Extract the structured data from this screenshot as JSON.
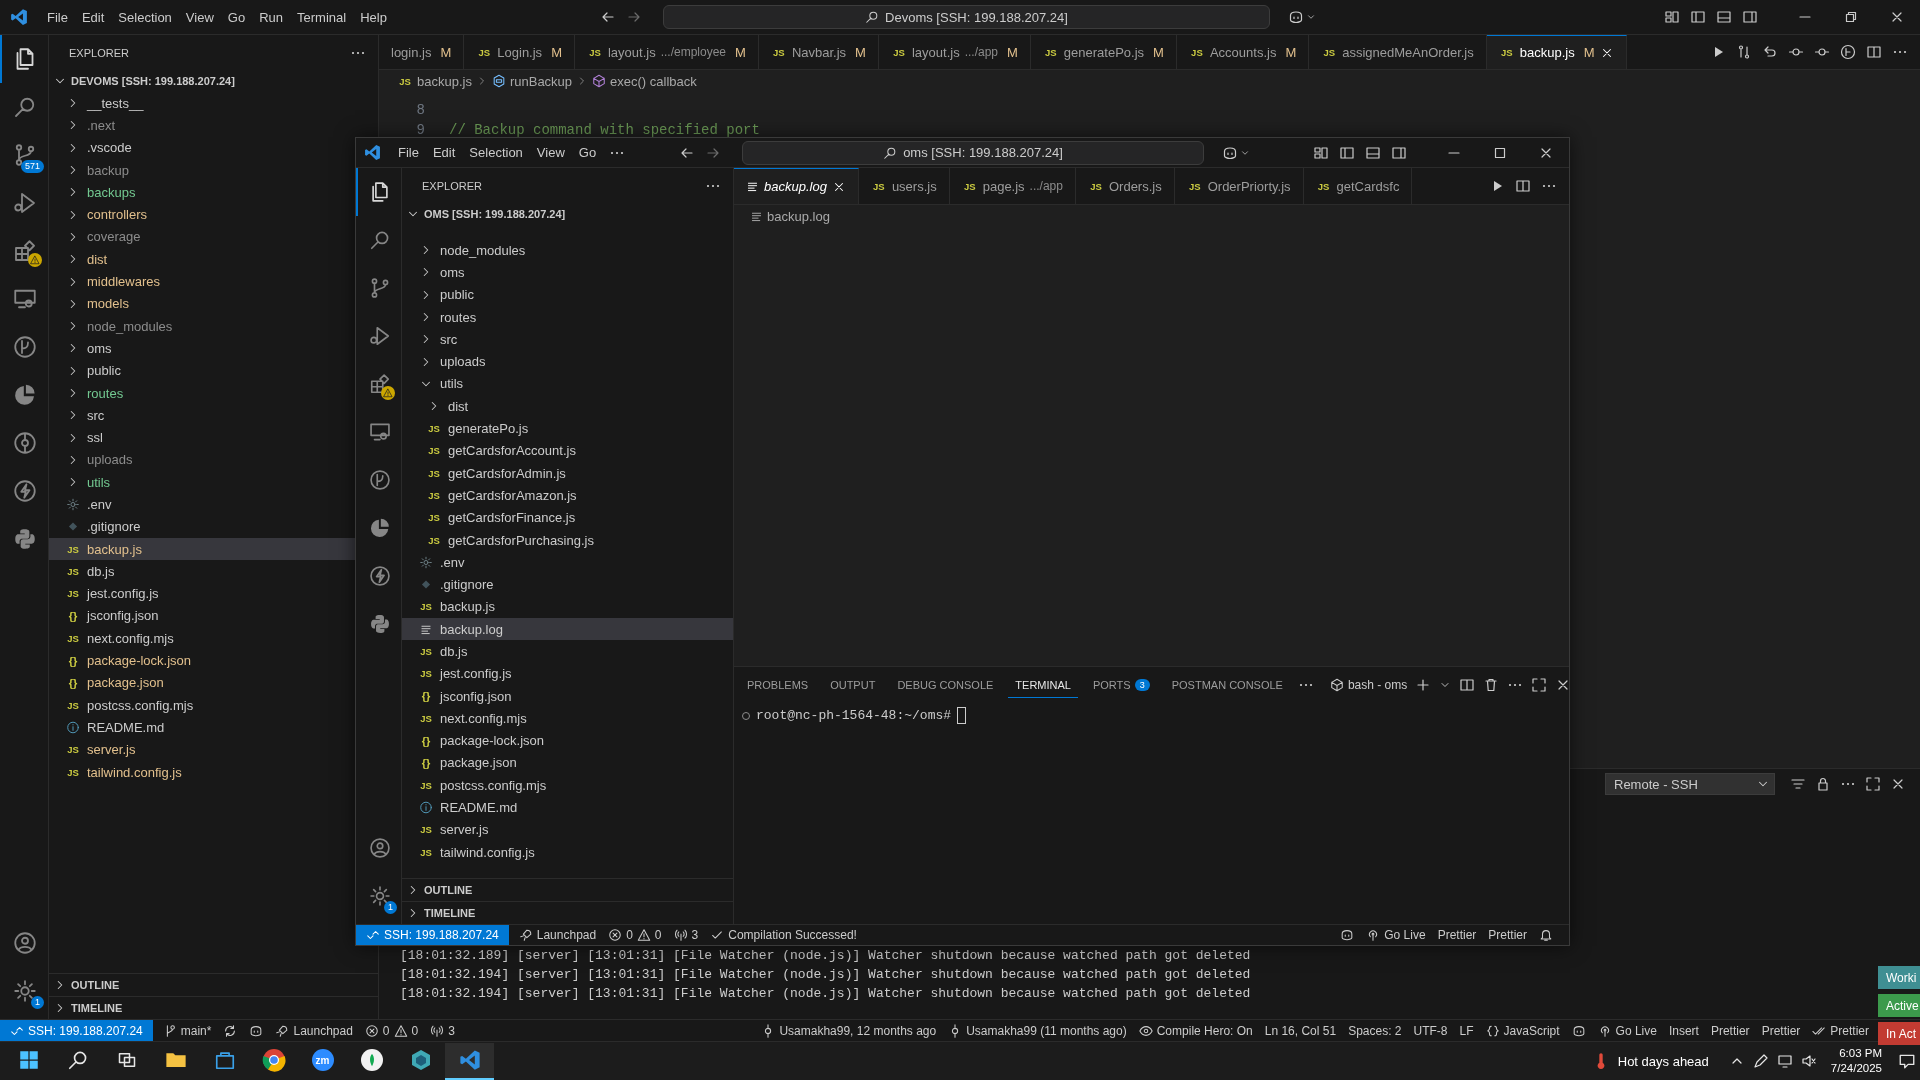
{
  "title_bar": {
    "menu": [
      "File",
      "Edit",
      "Selection",
      "View",
      "Go",
      "Run",
      "Terminal",
      "Help"
    ],
    "search": "Devoms [SSH: 199.188.207.24]"
  },
  "activity_bar": {
    "top": [
      {
        "kind": "files",
        "selected": true
      },
      {
        "kind": "search",
        "selected": false
      },
      {
        "kind": "scm",
        "selected": false,
        "badge": "571"
      },
      {
        "kind": "debug",
        "selected": false
      },
      {
        "kind": "extensions",
        "selected": false,
        "alert": true
      },
      {
        "kind": "remote",
        "selected": false
      },
      {
        "kind": "gitgraph",
        "selected": false
      },
      {
        "kind": "pie",
        "selected": false
      },
      {
        "kind": "gitlens",
        "selected": false
      },
      {
        "kind": "bolt",
        "selected": false
      },
      {
        "kind": "python",
        "selected": false
      }
    ],
    "bottom": [
      {
        "kind": "account",
        "selected": false
      },
      {
        "kind": "settings",
        "selected": false,
        "badge": "1"
      }
    ]
  },
  "explorer": {
    "title": "EXPLORER",
    "root": "DEVOMS [SSH: 199.188.207.24]",
    "items": [
      {
        "kind": "folder",
        "name": "__tests__",
        "color": "#cccccc",
        "expanded": false,
        "selected": false
      },
      {
        "kind": "folder",
        "name": ".next",
        "color": "#8c8c8c",
        "expanded": false,
        "selected": false
      },
      {
        "kind": "folder",
        "name": ".vscode",
        "color": "#cccccc",
        "expanded": false,
        "selected": false
      },
      {
        "kind": "folder",
        "name": "backup",
        "color": "#8c8c8c",
        "expanded": false,
        "selected": false
      },
      {
        "kind": "folder",
        "name": "backups",
        "color": "#73c991",
        "expanded": false,
        "selected": false
      },
      {
        "kind": "folder",
        "name": "controllers",
        "color": "#e2c08d",
        "expanded": false,
        "selected": false
      },
      {
        "kind": "folder",
        "name": "coverage",
        "color": "#8c8c8c",
        "expanded": false,
        "selected": false
      },
      {
        "kind": "folder",
        "name": "dist",
        "color": "#e2c08d",
        "expanded": false,
        "selected": false
      },
      {
        "kind": "folder",
        "name": "middlewares",
        "color": "#e2c08d",
        "expanded": false,
        "selected": false
      },
      {
        "kind": "folder",
        "name": "models",
        "color": "#e2c08d",
        "expanded": false,
        "selected": false
      },
      {
        "kind": "folder",
        "name": "node_modules",
        "color": "#8c8c8c",
        "expanded": false,
        "selected": false
      },
      {
        "kind": "folder",
        "name": "oms",
        "color": "#cccccc",
        "expanded": false,
        "selected": false
      },
      {
        "kind": "folder",
        "name": "public",
        "color": "#cccccc",
        "expanded": false,
        "selected": false
      },
      {
        "kind": "folder",
        "name": "routes",
        "color": "#73c991",
        "expanded": false,
        "selected": false
      },
      {
        "kind": "folder",
        "name": "src",
        "color": "#cccccc",
        "expanded": false,
        "selected": false
      },
      {
        "kind": "folder",
        "name": "ssl",
        "color": "#cccccc",
        "expanded": false,
        "selected": false
      },
      {
        "kind": "folder",
        "name": "uploads",
        "color": "#8c8c8c",
        "expanded": false,
        "selected": false
      },
      {
        "kind": "folder",
        "name": "utils",
        "color": "#73c991",
        "expanded": false,
        "selected": false
      },
      {
        "kind": "env",
        "name": ".env",
        "color": "#cccccc",
        "selected": false
      },
      {
        "kind": "git",
        "name": ".gitignore",
        "color": "#cccccc",
        "selected": false
      },
      {
        "kind": "js",
        "glyph": "JS",
        "name": "backup.js",
        "color": "#e2c08d",
        "selected": true
      },
      {
        "kind": "js",
        "glyph": "JS",
        "name": "db.js",
        "color": "#cccccc",
        "selected": false
      },
      {
        "kind": "js",
        "glyph": "JS",
        "name": "jest.config.js",
        "color": "#cccccc",
        "selected": false
      },
      {
        "kind": "json",
        "glyph": "{}",
        "name": "jsconfig.json",
        "color": "#cccccc",
        "selected": false
      },
      {
        "kind": "js",
        "glyph": "JS",
        "name": "next.config.mjs",
        "color": "#cccccc",
        "selected": false
      },
      {
        "kind": "json",
        "glyph": "{}",
        "name": "package-lock.json",
        "color": "#e2c08d",
        "selected": false
      },
      {
        "kind": "json",
        "glyph": "{}",
        "name": "package.json",
        "color": "#e2c08d",
        "selected": false
      },
      {
        "kind": "js",
        "glyph": "JS",
        "name": "postcss.config.mjs",
        "color": "#cccccc",
        "selected": false
      },
      {
        "kind": "info",
        "name": "README.md",
        "color": "#cccccc",
        "selected": false
      },
      {
        "kind": "js",
        "glyph": "JS",
        "name": "server.js",
        "color": "#e2c08d",
        "selected": false
      },
      {
        "kind": "js",
        "glyph": "JS",
        "name": "tailwind.config.js",
        "color": "#e2c08d",
        "selected": false
      }
    ],
    "sections": [
      "OUTLINE",
      "TIMELINE"
    ]
  },
  "tabs": [
    {
      "name": "login.js",
      "status": "M",
      "selected": false
    },
    {
      "glyph": "JS",
      "name": "Login.js",
      "status": "M",
      "selected": false
    },
    {
      "glyph": "JS",
      "name": "layout.js",
      "desc": ".../employee",
      "status": "M",
      "selected": false
    },
    {
      "glyph": "JS",
      "name": "Navbar.js",
      "status": "M",
      "selected": false
    },
    {
      "glyph": "JS",
      "name": "layout.js",
      "desc": ".../app",
      "status": "M",
      "selected": false
    },
    {
      "glyph": "JS",
      "name": "generatePo.js",
      "status": "M",
      "selected": false
    },
    {
      "glyph": "JS",
      "name": "Accounts.js",
      "status": "M",
      "selected": false
    },
    {
      "glyph": "JS",
      "name": "assignedMeAnOrder.js",
      "selected": false
    },
    {
      "glyph": "JS",
      "name": "backup.js",
      "status": "M",
      "selected": true
    }
  ],
  "breadcrumb": [
    {
      "kind": "file",
      "glyph": "JS",
      "text": "backup.js"
    },
    {
      "kind": "method",
      "text": "runBackup"
    },
    {
      "kind": "function",
      "text": "exec() callback"
    }
  ],
  "code": [
    {
      "num": "8"
    },
    {
      "num": "9",
      "text": "// Backup command with specified port"
    }
  ],
  "output_panel": {
    "channel": "Remote - SSH",
    "lines": [
      "[18:01:32.189] [server] [13:01:31] [File Watcher (node.js)] Watcher shutdown because watched path got deleted",
      "[18:01:32.194] [server] [13:01:31] [File Watcher (node.js)] Watcher shutdown because watched path got deleted",
      "[18:01:32.194] [server] [13:01:31] [File Watcher (node.js)] Watcher shutdown because watched path got deleted"
    ]
  },
  "status_bar": {
    "left": [
      {
        "kind": "remote",
        "text": "SSH: 199.188.207.24"
      },
      {
        "kind": "branch",
        "text": "main*"
      },
      {
        "kind": "sync"
      },
      {
        "kind": "copilot"
      },
      {
        "kind": "launchpad",
        "text": "Launchpad"
      },
      {
        "kind": "problems",
        "errors": "0",
        "warnings": "0"
      },
      {
        "kind": "ports",
        "text": "3"
      }
    ],
    "right": [
      {
        "kind": "blame",
        "text": "Usamakha99, 12 months ago"
      },
      {
        "kind": "commit",
        "text": "Usamakha99 (11 months ago)"
      },
      {
        "kind": "compile",
        "text": "Compile Hero: On"
      },
      {
        "kind": "cursor",
        "text": "Ln 16, Col 51"
      },
      {
        "kind": "indent",
        "text": "Spaces: 2"
      },
      {
        "kind": "encoding",
        "text": "UTF-8"
      },
      {
        "kind": "eol",
        "text": "LF"
      },
      {
        "kind": "language",
        "text": "JavaScript"
      },
      {
        "kind": "copilot"
      },
      {
        "kind": "live",
        "text": "Go Live"
      },
      {
        "kind": "mode",
        "text": "Insert"
      },
      {
        "kind": "formatter",
        "text": "Prettier"
      },
      {
        "kind": "formatter",
        "text": "Prettier"
      },
      {
        "kind": "formatter-check",
        "text": "Prettier"
      }
    ]
  },
  "notifications": [
    {
      "text": "Worki",
      "color": "#3f8f93"
    },
    {
      "text": "Active",
      "color": "#3c9a4c"
    },
    {
      "text": "In Act",
      "color": "#c23b32"
    }
  ],
  "inner": {
    "title_bar": {
      "menu": [
        "File",
        "Edit",
        "Selection",
        "View",
        "Go"
      ],
      "search": "oms [SSH: 199.188.207.24]"
    },
    "activity_bar": {
      "top": [
        {
          "kind": "files",
          "selected": true
        },
        {
          "kind": "search",
          "selected": false
        },
        {
          "kind": "scm",
          "selected": false
        },
        {
          "kind": "debug",
          "selected": false
        },
        {
          "kind": "extensions",
          "selected": false,
          "alert": true
        },
        {
          "kind": "remote",
          "selected": false
        },
        {
          "kind": "gitgraph",
          "selected": false
        },
        {
          "kind": "pie",
          "selected": false
        },
        {
          "kind": "bolt",
          "selected": false
        },
        {
          "kind": "python",
          "selected": false
        }
      ],
      "bottom": [
        {
          "kind": "account",
          "selected": false
        },
        {
          "kind": "settings",
          "selected": false,
          "badge": "1"
        }
      ]
    },
    "explorer": {
      "title": "EXPLORER",
      "root": "OMS [SSH: 199.188.207.24]",
      "items": [
        {
          "kind": "folder",
          "name": "node_modules",
          "expanded": false,
          "selected": false
        },
        {
          "kind": "folder",
          "name": "oms",
          "expanded": false,
          "selected": false
        },
        {
          "kind": "folder",
          "name": "public",
          "expanded": false,
          "selected": false
        },
        {
          "kind": "folder",
          "name": "routes",
          "expanded": false,
          "selected": false
        },
        {
          "kind": "folder",
          "name": "src",
          "expanded": false,
          "selected": false
        },
        {
          "kind": "folder",
          "name": "uploads",
          "expanded": false,
          "selected": false
        },
        {
          "kind": "folder",
          "name": "utils",
          "expanded": true,
          "selected": false,
          "children": [
            {
              "kind": "folder",
              "name": "dist",
              "expanded": false,
              "selected": false
            },
            {
              "kind": "js",
              "glyph": "JS",
              "name": "generatePo.js",
              "selected": false
            },
            {
              "kind": "js",
              "glyph": "JS",
              "name": "getCardsforAccount.js",
              "selected": false
            },
            {
              "kind": "js",
              "glyph": "JS",
              "name": "getCardsforAdmin.js",
              "selected": false
            },
            {
              "kind": "js",
              "glyph": "JS",
              "name": "getCardsforAmazon.js",
              "selected": false
            },
            {
              "kind": "js",
              "glyph": "JS",
              "name": "getCardsforFinance.js",
              "selected": false
            },
            {
              "kind": "js",
              "glyph": "JS",
              "name": "getCardsforPurchasing.js",
              "selected": false
            }
          ]
        },
        {
          "kind": "env",
          "name": ".env",
          "selected": false
        },
        {
          "kind": "git",
          "name": ".gitignore",
          "selected": false
        },
        {
          "kind": "js",
          "glyph": "JS",
          "name": "backup.js",
          "selected": false
        },
        {
          "kind": "log",
          "name": "backup.log",
          "selected": true
        },
        {
          "kind": "js",
          "glyph": "JS",
          "name": "db.js",
          "selected": false
        },
        {
          "kind": "js",
          "glyph": "JS",
          "name": "jest.config.js",
          "selected": false
        },
        {
          "kind": "json",
          "glyph": "{}",
          "name": "jsconfig.json",
          "selected": false
        },
        {
          "kind": "js",
          "glyph": "JS",
          "name": "next.config.mjs",
          "selected": false
        },
        {
          "kind": "json",
          "glyph": "{}",
          "name": "package-lock.json",
          "selected": false
        },
        {
          "kind": "json",
          "glyph": "{}",
          "name": "package.json",
          "selected": false
        },
        {
          "kind": "js",
          "glyph": "JS",
          "name": "postcss.config.mjs",
          "selected": false
        },
        {
          "kind": "info",
          "name": "README.md",
          "selected": false
        },
        {
          "kind": "js",
          "glyph": "JS",
          "name": "server.js",
          "selected": false
        },
        {
          "kind": "js",
          "glyph": "JS",
          "name": "tailwind.config.js",
          "selected": false
        }
      ],
      "sections": [
        "OUTLINE",
        "TIMELINE"
      ]
    },
    "tabs": [
      {
        "kind": "log",
        "name": "backup.log",
        "selected": true
      },
      {
        "kind": "js",
        "glyph": "JS",
        "name": "users.js",
        "selected": false
      },
      {
        "kind": "js",
        "glyph": "JS",
        "name": "page.js",
        "desc": ".../app",
        "selected": false
      },
      {
        "kind": "js",
        "glyph": "JS",
        "name": "Orders.js",
        "selected": false
      },
      {
        "kind": "js",
        "glyph": "JS",
        "name": "OrderPriorty.js",
        "selected": false
      },
      {
        "kind": "js",
        "glyph": "JS",
        "name": "getCardsfc",
        "selected": false
      }
    ],
    "breadcrumb": "backup.log",
    "panel": {
      "tabs": [
        {
          "label": "PROBLEMS",
          "selected": false
        },
        {
          "label": "OUTPUT",
          "selected": false
        },
        {
          "label": "DEBUG CONSOLE",
          "selected": false
        },
        {
          "label": "TERMINAL",
          "selected": true
        },
        {
          "label": "PORTS",
          "badge": "3",
          "selected": false
        },
        {
          "label": "POSTMAN CONSOLE",
          "selected": false
        }
      ],
      "shell": "bash - oms",
      "prompt": "root@nc-ph-1564-48:~/oms#"
    },
    "status_bar": {
      "left": [
        {
          "kind": "remote",
          "text": "SSH: 199.188.207.24"
        },
        {
          "kind": "launchpad",
          "text": "Launchpad"
        },
        {
          "kind": "problems",
          "errors": "0",
          "warnings": "0"
        },
        {
          "kind": "ports",
          "text": "3"
        },
        {
          "kind": "build",
          "text": "Compilation Successed!"
        }
      ],
      "right": [
        {
          "kind": "copilot"
        },
        {
          "kind": "live",
          "text": "Go Live"
        },
        {
          "kind": "formatter",
          "text": "Prettier"
        },
        {
          "kind": "formatter",
          "text": "Prettier"
        },
        {
          "kind": "notifications"
        }
      ]
    }
  },
  "taskbar": {
    "apps": [
      {
        "kind": "start",
        "selected": false
      },
      {
        "kind": "search",
        "selected": false
      },
      {
        "kind": "taskview",
        "selected": false
      },
      {
        "kind": "files",
        "selected": false
      },
      {
        "kind": "store",
        "selected": false
      },
      {
        "kind": "chrome",
        "selected": false
      },
      {
        "kind": "zoom",
        "label": "zm",
        "selected": false
      },
      {
        "kind": "leaf",
        "selected": false
      },
      {
        "kind": "cube",
        "selected": false
      },
      {
        "kind": "vscode",
        "selected": true
      }
    ],
    "weather": "Hot days ahead",
    "time": "6:03 PM",
    "date": "7/24/2025"
  }
}
